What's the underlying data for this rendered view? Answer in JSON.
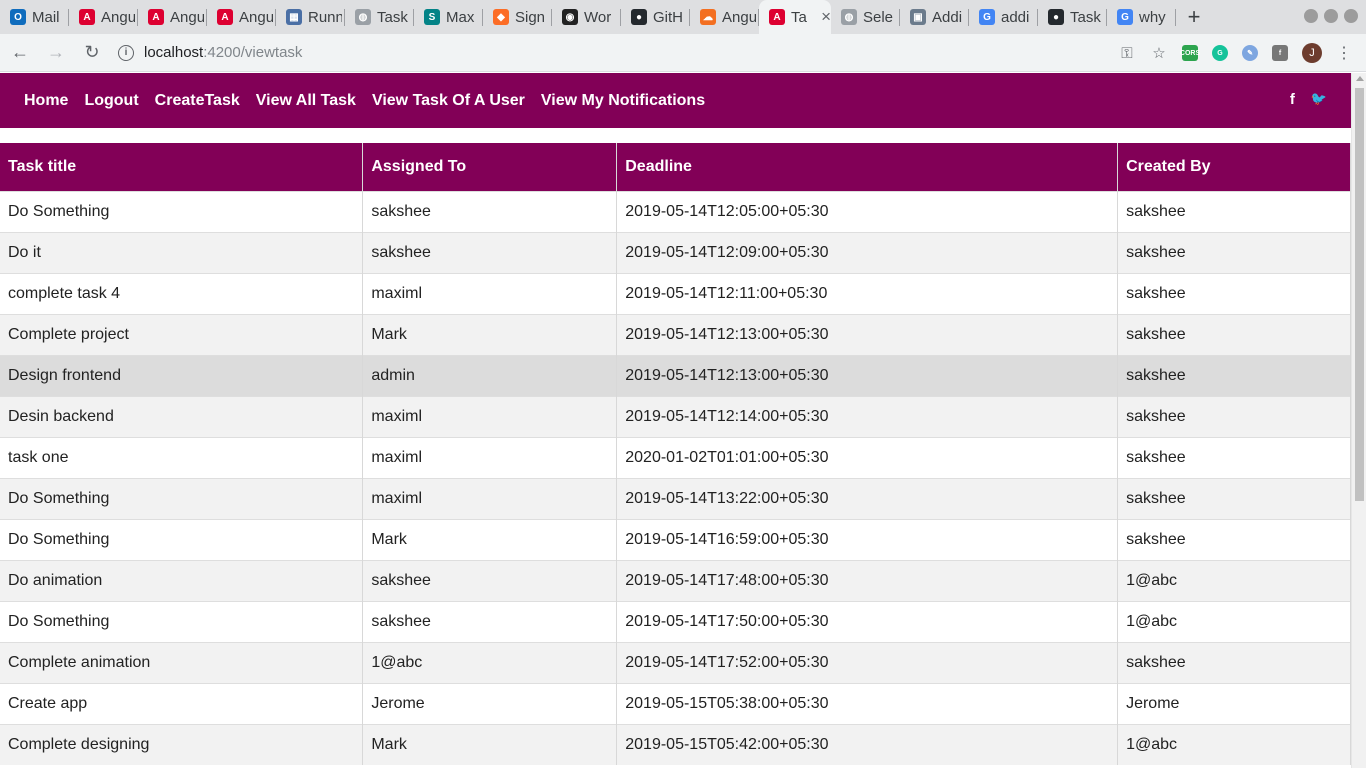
{
  "browser": {
    "tabs": [
      {
        "title": "Mail",
        "icon": "outlook-icon",
        "color": "#0f6cbd",
        "glyph": "O"
      },
      {
        "title": "Angu",
        "icon": "angular-icon",
        "color": "#dd0031",
        "glyph": "A"
      },
      {
        "title": "Angu",
        "icon": "angular-icon",
        "color": "#dd0031",
        "glyph": "A"
      },
      {
        "title": "Angu",
        "icon": "angular-icon",
        "color": "#dd0031",
        "glyph": "A"
      },
      {
        "title": "Runn",
        "icon": "document-icon",
        "color": "#4a6fa5",
        "glyph": "▦"
      },
      {
        "title": "Task",
        "icon": "globe-icon",
        "color": "#9aa0a6",
        "glyph": "◍"
      },
      {
        "title": "Max",
        "icon": "sharepoint-icon",
        "color": "#038387",
        "glyph": "S"
      },
      {
        "title": "Sign",
        "icon": "gitlab-icon",
        "color": "#fc6d26",
        "glyph": "◆"
      },
      {
        "title": "Wor",
        "icon": "owl-icon",
        "color": "#222222",
        "glyph": "◉"
      },
      {
        "title": "GitH",
        "icon": "github-icon",
        "color": "#24292e",
        "glyph": "●"
      },
      {
        "title": "Angu",
        "icon": "cloud-icon",
        "color": "#f36f21",
        "glyph": "☁"
      },
      {
        "title": "Ta",
        "icon": "angular-icon",
        "color": "#dd0031",
        "glyph": "A",
        "active": true
      },
      {
        "title": "Sele",
        "icon": "globe-icon",
        "color": "#9aa0a6",
        "glyph": "◍"
      },
      {
        "title": "Addi",
        "icon": "image-icon",
        "color": "#6b7b8c",
        "glyph": "▣"
      },
      {
        "title": "addi",
        "icon": "google-icon",
        "color": "#4285f4",
        "glyph": "G"
      },
      {
        "title": "Task",
        "icon": "github-icon",
        "color": "#24292e",
        "glyph": "●"
      },
      {
        "title": "why",
        "icon": "google-icon",
        "color": "#4285f4",
        "glyph": "G"
      }
    ],
    "new_tab": "+",
    "close_glyph": "×",
    "url_host": "localhost",
    "url_path": ":4200/viewtask"
  },
  "nav": {
    "home": "Home",
    "logout": "Logout",
    "create": "CreateTask",
    "view_all": "View All Task",
    "view_user": "View Task Of A User",
    "notifications": "View My Notifications",
    "facebook": "f",
    "twitter": "🐦"
  },
  "table": {
    "headers": [
      "Task title",
      "Assigned To",
      "Deadline",
      "Created By"
    ],
    "rows": [
      [
        "Do Something",
        "sakshee",
        "2019-05-14T12:05:00+05:30",
        "sakshee"
      ],
      [
        "Do it",
        "sakshee",
        "2019-05-14T12:09:00+05:30",
        "sakshee"
      ],
      [
        "complete task 4",
        "maximl",
        "2019-05-14T12:11:00+05:30",
        "sakshee"
      ],
      [
        "Complete project",
        "Mark",
        "2019-05-14T12:13:00+05:30",
        "sakshee"
      ],
      [
        "Design frontend",
        "admin",
        "2019-05-14T12:13:00+05:30",
        "sakshee"
      ],
      [
        "Desin backend",
        "maximl",
        "2019-05-14T12:14:00+05:30",
        "sakshee"
      ],
      [
        "task one",
        "maximl",
        "2020-01-02T01:01:00+05:30",
        "sakshee"
      ],
      [
        "Do Something",
        "maximl",
        "2019-05-14T13:22:00+05:30",
        "sakshee"
      ],
      [
        "Do Something",
        "Mark",
        "2019-05-14T16:59:00+05:30",
        "sakshee"
      ],
      [
        "Do animation",
        "sakshee",
        "2019-05-14T17:48:00+05:30",
        "1@abc"
      ],
      [
        "Do Something",
        "sakshee",
        "2019-05-14T17:50:00+05:30",
        "1@abc"
      ],
      [
        "Complete animation",
        "1@abc",
        "2019-05-14T17:52:00+05:30",
        "sakshee"
      ],
      [
        "Create app",
        "Jerome",
        "2019-05-15T05:38:00+05:30",
        "Jerome"
      ],
      [
        "Complete designing",
        "Mark",
        "2019-05-15T05:42:00+05:30",
        "1@abc"
      ]
    ]
  },
  "colors": {
    "brand": "#820057",
    "row_alt": "#f2f2f2",
    "row_hover": "#dcdcdc"
  }
}
